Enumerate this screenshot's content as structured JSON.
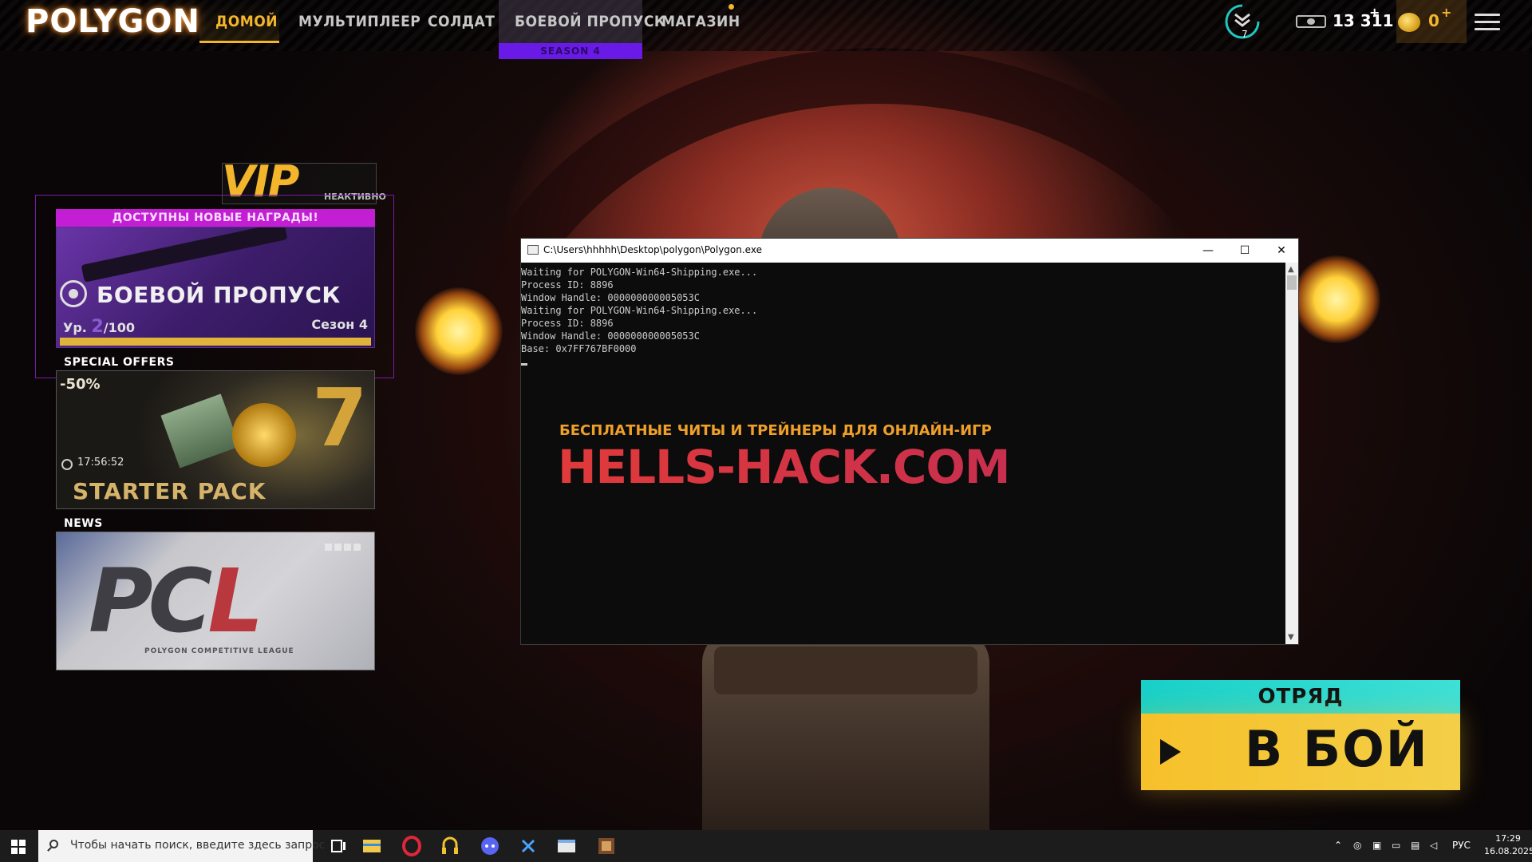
{
  "nav": {
    "logo": "POLYGON",
    "items": [
      "ДОМОЙ",
      "МУЛЬТИПЛЕЕР",
      "СОЛДАТ",
      "БОЕВОЙ ПРОПУСК",
      "МАГАЗИН"
    ],
    "season_badge": "SEASON 4",
    "rank_level": "7",
    "cash": "13 311",
    "gold": "0",
    "plus": "+"
  },
  "vip": {
    "label": "VIP",
    "status": "НЕАКТИВНО"
  },
  "battle_pass": {
    "banner": "ДОСТУПНЫ НОВЫЕ НАГРАДЫ!",
    "title": "БОЕВОЙ ПРОПУСК",
    "level_prefix": "Ур.",
    "level": "2",
    "level_max": "/100",
    "season": "Сезон 4",
    "progress": 1.0
  },
  "offers": {
    "section": "SPECIAL OFFERS",
    "discount": "-50%",
    "timer": "17:56:52",
    "title": "STARTER PACK",
    "badge": "7"
  },
  "news": {
    "section": "NEWS",
    "logo_a": "PC",
    "logo_b": "L",
    "subtitle": "POLYGON COMPETITIVE LEAGUE"
  },
  "play": {
    "squad": "ОТРЯД",
    "fight": "В БОЙ"
  },
  "console": {
    "title": "C:\\Users\\hhhhh\\Desktop\\polygon\\Polygon.exe",
    "lines": [
      "Waiting for POLYGON-Win64-Shipping.exe...",
      "Process ID: 8896",
      "Window Handle: 000000000005053C",
      "Waiting for POLYGON-Win64-Shipping.exe...",
      "Process ID: 8896",
      "Window Handle: 000000000005053C",
      "Base: 0x7FF767BF0000"
    ],
    "minimize": "—",
    "maximize": "☐",
    "close": "✕",
    "watermark_line1": "БЕСПЛАТНЫЕ ЧИТЫ И ТРЕЙНЕРЫ ДЛЯ ОНЛАЙН-ИГР",
    "watermark_line2": "HELLS-HACK.COM"
  },
  "taskbar": {
    "search_placeholder": "Чтобы начать поиск, введите здесь запрос",
    "language": "РУС",
    "time": "17:29",
    "date": "16.08.2025"
  },
  "colors": {
    "accent_gold": "#f2b52c",
    "season_purple": "#6a1ae6",
    "rewards_magenta": "#c41ed4",
    "squad_teal": "#18d0c8",
    "play_yellow": "#f6c02a"
  }
}
